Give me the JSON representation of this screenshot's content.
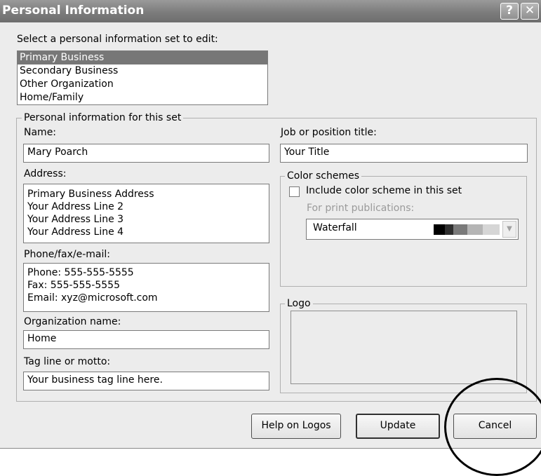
{
  "window": {
    "title": "Personal Information"
  },
  "titlebar_buttons": {
    "help": "?",
    "close": "✕"
  },
  "selector": {
    "label": "Select a personal information set to edit:",
    "items": [
      "Primary Business",
      "Secondary Business",
      "Other Organization",
      "Home/Family"
    ],
    "selected": "Primary Business"
  },
  "set_group": {
    "legend": "Personal information for this set",
    "name": {
      "label": "Name:",
      "value": "Mary Poarch"
    },
    "address": {
      "label": "Address:",
      "lines": [
        "Primary Business Address",
        "Your Address Line 2",
        "Your Address Line 3",
        "Your Address Line 4"
      ]
    },
    "contact": {
      "label": "Phone/fax/e-mail:",
      "lines": [
        "Phone: 555-555-5555",
        "Fax: 555-555-5555",
        "Email: xyz@microsoft.com"
      ]
    },
    "organization": {
      "label": "Organization name:",
      "value": "Home"
    },
    "tagline": {
      "label": "Tag line or motto:",
      "value": "Your business tag line here."
    },
    "job_title": {
      "label": "Job or position title:",
      "value": "Your Title"
    },
    "color_schemes": {
      "legend": "Color schemes",
      "include_label": "Include color scheme in this set",
      "include_checked": false,
      "print_label": "For print publications:",
      "scheme_value": "Waterfall",
      "swatch_colors": [
        "#000000",
        "#2e2e2e",
        "#7a7a7a",
        "#b5b5b5",
        "#d6d6d6"
      ]
    },
    "logo": {
      "legend": "Logo"
    }
  },
  "buttons": {
    "help_logos": "Help on Logos",
    "update": "Update",
    "cancel": "Cancel"
  }
}
